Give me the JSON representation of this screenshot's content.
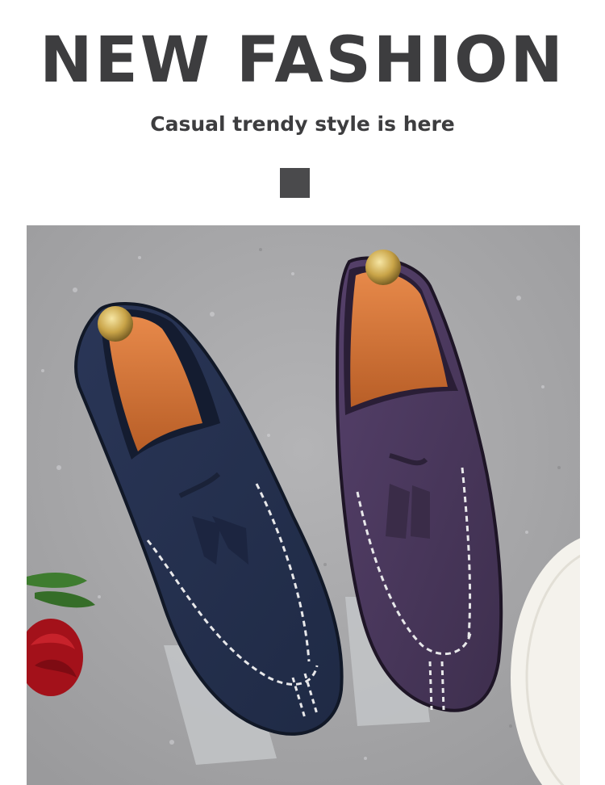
{
  "banner": {
    "headline": "NEW FASHION",
    "tagline": "Casual trendy style is here"
  },
  "photo": {
    "subject": "two suede tassel loafers",
    "shoes": [
      {
        "color_name": "navy blue suede",
        "color": "#2c3a5c"
      },
      {
        "color_name": "purple suede",
        "color": "#4e3a5e"
      }
    ],
    "props": [
      "red rose",
      "wooden shoe trees",
      "straw hat brim",
      "acrylic stands"
    ],
    "background_color": "#a9a9ab"
  },
  "colors": {
    "text": "#3d3d3f",
    "accent_square": "#4a4a4c"
  }
}
